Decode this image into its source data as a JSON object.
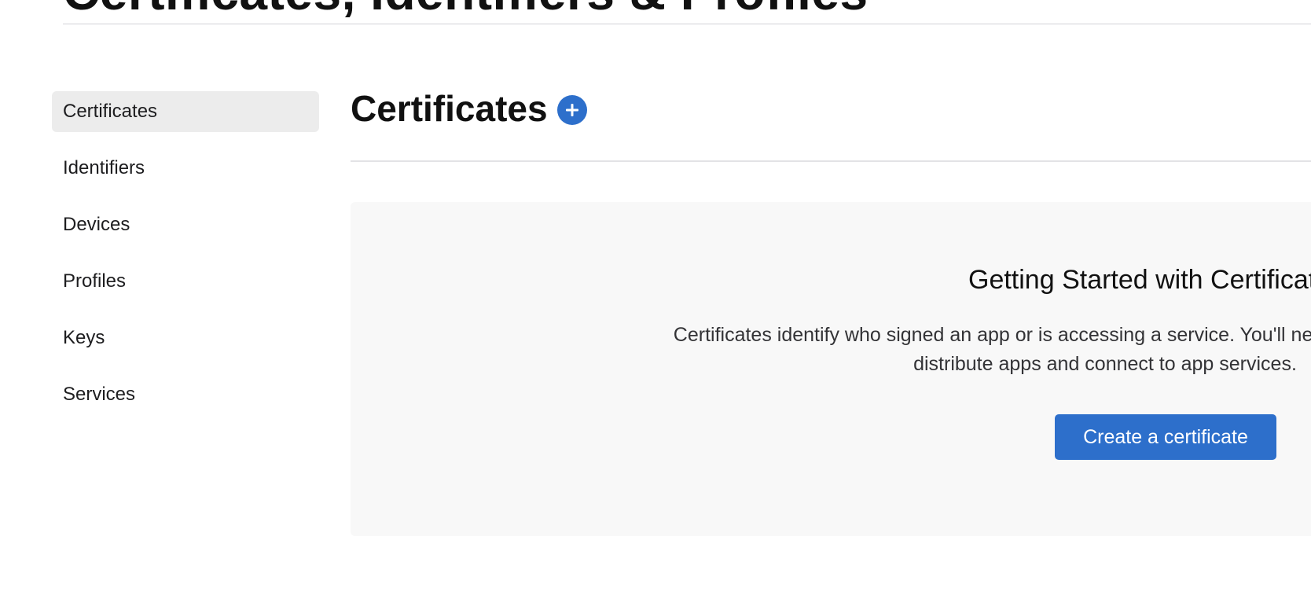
{
  "page": {
    "heading": "Certificates, Identifiers & Profiles"
  },
  "sidebar": {
    "items": [
      {
        "label": "Certificates",
        "active": true
      },
      {
        "label": "Identifiers",
        "active": false
      },
      {
        "label": "Devices",
        "active": false
      },
      {
        "label": "Profiles",
        "active": false
      },
      {
        "label": "Keys",
        "active": false
      },
      {
        "label": "Services",
        "active": false
      }
    ]
  },
  "main": {
    "section_title": "Certificates",
    "add_icon": "plus-circle-icon",
    "panel": {
      "title": "Getting Started with Certificates",
      "description_line1": "Certificates identify who signed an app or is accessing a service. You'll need to set up certificates to",
      "description_line2": "distribute apps and connect to app services.",
      "button_label": "Create a certificate"
    }
  },
  "colors": {
    "accent": "#2d6fcb",
    "sidebar_active_bg": "#ececec",
    "panel_bg": "#f8f8f8"
  }
}
